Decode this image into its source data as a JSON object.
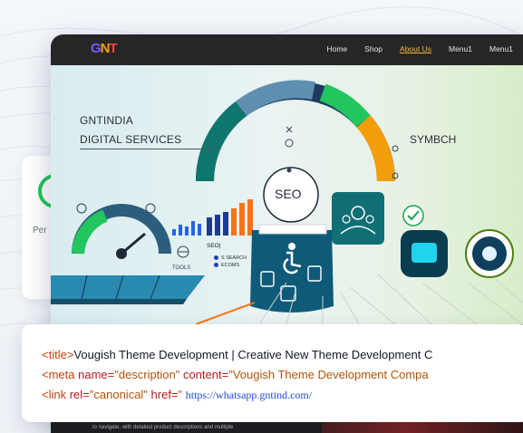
{
  "back_card": {
    "label": "Per"
  },
  "site": {
    "logo_text": "GNT",
    "nav": [
      "Home",
      "Shop",
      "About Us",
      "Menu1",
      "Menu1"
    ],
    "active_nav": "About Us",
    "hero": {
      "title_line1": "GNTINDIA",
      "title_line2": "DIGITAL SERVICES",
      "right_title": "SYMBCH",
      "gauge_label": "SEO",
      "tools_label": "TOOLS",
      "seo_small_label": "SEO|",
      "legend": [
        "S SEARCH",
        "ECOMS"
      ]
    },
    "lower_text": "to navigate, with detailed product descriptions and multiple"
  },
  "code": {
    "line1": {
      "open_tag": "<title>",
      "text": "Vougish Theme Development | Creative New Theme Development C"
    },
    "line2": {
      "open_tag": "<meta ",
      "attr1": "name=",
      "val1": "\"description\"",
      "attr2": " content=",
      "val2": "\"Vougish Theme Development Compa"
    },
    "line3": {
      "open_tag": "<link ",
      "attr1": "rel=",
      "val1": "\"canonical\"",
      "attr2": " href=",
      "val2": "\" ",
      "url": "https://whatsapp.gntind.com/"
    }
  },
  "colors": {
    "accent_orange": "#f5b942",
    "gauge_green": "#22c55e",
    "code_tag": "#c2410c",
    "code_link": "#1d4ed8"
  }
}
